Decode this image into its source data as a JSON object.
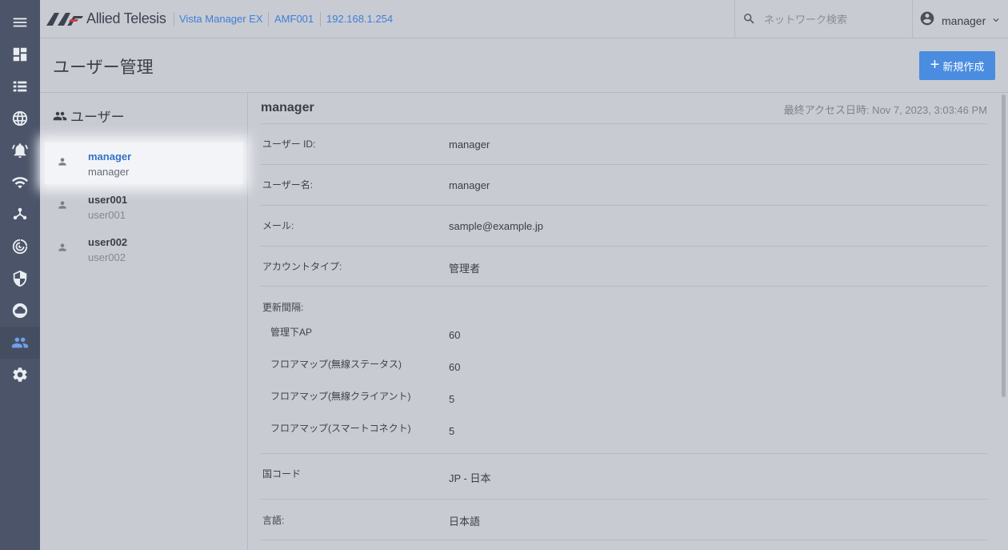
{
  "header": {
    "brand": "Allied Telesis",
    "breadcrumbs": [
      "Vista Manager EX",
      "AMF001",
      "192.168.1.254"
    ],
    "search_placeholder": "ネットワーク検索",
    "username": "manager"
  },
  "page": {
    "title": "ユーザー管理",
    "new_button": "新規作成"
  },
  "users_panel": {
    "heading": "ユーザー",
    "users": [
      {
        "name": "manager",
        "username": "manager",
        "selected": true
      },
      {
        "name": "user001",
        "username": "user001",
        "selected": false
      },
      {
        "name": "user002",
        "username": "user002",
        "selected": false
      }
    ]
  },
  "detail": {
    "title": "manager",
    "last_access": "最終アクセス日時: Nov 7, 2023, 3:03:46 PM",
    "user_id_label": "ユーザー ID:",
    "user_id": "manager",
    "user_name_label": "ユーザー名:",
    "user_name": "manager",
    "email_label": "メール:",
    "email": "sample@example.jp",
    "account_type_label": "アカウントタイプ:",
    "account_type": "管理者",
    "refresh_label": "更新間隔:",
    "refresh": [
      {
        "label": "管理下AP",
        "value": "60"
      },
      {
        "label": "フロアマップ(無線ステータス)",
        "value": "60"
      },
      {
        "label": "フロアマップ(無線クライアント)",
        "value": "5"
      },
      {
        "label": "フロアマップ(スマートコネクト)",
        "value": "5"
      }
    ],
    "country_label": "国コード",
    "country": "JP - 日本",
    "language_label": "言語:",
    "language": "日本語"
  },
  "colors": {
    "rail": "#4b5468",
    "accent": "#4a8ce0",
    "background": "#c8cbd2"
  }
}
